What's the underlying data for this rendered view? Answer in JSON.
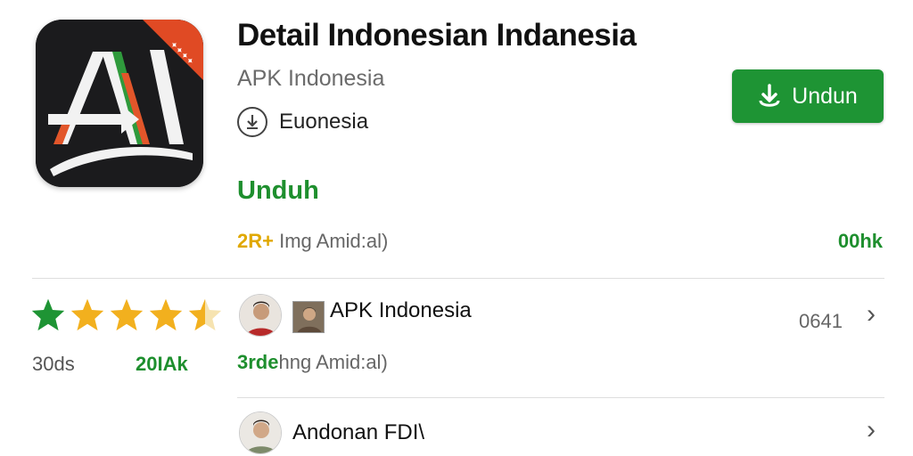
{
  "app": {
    "title": "Detail Indonesian Indanesia",
    "publisher": "APK Indonesia",
    "category": "Euonesia",
    "icon": "ai-logo-icon"
  },
  "actions": {
    "install_label": "Undun",
    "install_icon": "download-icon",
    "unduh_link": "Unduh"
  },
  "meta": {
    "highlight": "2R+",
    "text": " Img Amid:al)",
    "right": "00hk"
  },
  "rating": {
    "stars": 4.5,
    "count": "30ds",
    "size": "20IAk"
  },
  "list": {
    "items": [
      {
        "label": "APK Indonesia",
        "count": "0641",
        "avatar": "person-avatar",
        "thumb": "person-thumbnail"
      },
      {
        "label": "Andonan FDI\\",
        "avatar": "person-avatar"
      }
    ],
    "sub_highlight": "3rde",
    "sub_text": "hng Amid:al)"
  },
  "colors": {
    "accent_green": "#1e9434",
    "link_green": "#1e8f2e",
    "star_gold": "#f2b01e",
    "star_green": "#1e9434",
    "icon_bg": "#1b1b1d",
    "corner_red": "#e04a24"
  }
}
